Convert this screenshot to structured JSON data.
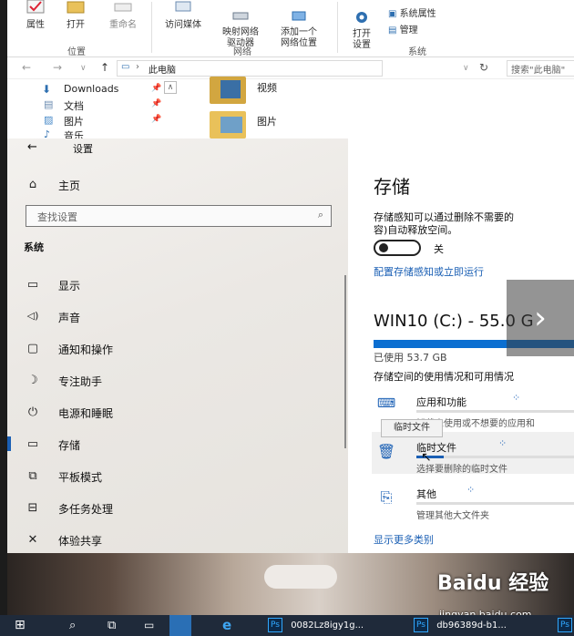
{
  "ribbon": {
    "properties_label": "属性",
    "open_label": "打开",
    "rename_label": "重命名",
    "access_media_label": "访问媒体",
    "map_network_drive_label": "映射网络\n驱动器",
    "add_network_location_label": "添加一个\n网络位置",
    "open_settings_label": "打开\n设置",
    "system_properties_label": "系统属性",
    "manage_label": "管理",
    "group_location": "位置",
    "group_network": "网络",
    "group_system": "系统"
  },
  "address": {
    "path": "此电脑",
    "search_placeholder": "搜索\"此电脑\""
  },
  "nav_pane": {
    "items": [
      {
        "label": "Downloads",
        "icon": "download-icon"
      },
      {
        "label": "文档",
        "icon": "document-icon"
      },
      {
        "label": "图片",
        "icon": "picture-icon"
      },
      {
        "label": "音乐",
        "icon": "music-icon"
      }
    ]
  },
  "folders": {
    "videos": "视频",
    "pictures": "图片"
  },
  "settings": {
    "back_label": "设置",
    "home_label": "主页",
    "search_placeholder": "查找设置",
    "section_title": "系统",
    "nav": [
      {
        "label": "显示",
        "icon": "monitor-icon"
      },
      {
        "label": "声音",
        "icon": "speaker-icon"
      },
      {
        "label": "通知和操作",
        "icon": "notification-icon"
      },
      {
        "label": "专注助手",
        "icon": "moon-icon"
      },
      {
        "label": "电源和睡眠",
        "icon": "power-icon"
      },
      {
        "label": "存储",
        "icon": "storage-icon"
      },
      {
        "label": "平板模式",
        "icon": "tablet-icon"
      },
      {
        "label": "多任务处理",
        "icon": "multitask-icon"
      },
      {
        "label": "体验共享",
        "icon": "share-icon"
      }
    ]
  },
  "storage": {
    "title": "存储",
    "sense_desc_1": "存储感知可以通过删除不需要的",
    "sense_desc_2": "容)自动释放空间。",
    "toggle_state": "关",
    "configure_link": "配置存储感知或立即运行",
    "drive_name": "WIN10 (C:) - 55.0 G",
    "used_text": "已使用 53.7 GB",
    "usage_heading": "存储空间的使用情况和可用情况",
    "drive_used_fraction": 0.98,
    "categories": [
      {
        "name": "应用和功能",
        "desc": "卸载未使用或不想要的应用和",
        "icon": "apps-icon"
      },
      {
        "name": "临时文件",
        "desc": "选择要删除的临时文件",
        "icon": "trash-icon"
      },
      {
        "name": "其他",
        "desc": "管理其他大文件夹",
        "icon": "folder-icon"
      }
    ],
    "show_more_link": "显示更多类别",
    "tooltip": "临时文件"
  },
  "taskbar": {
    "task1": "0082Lz8igy1g...",
    "task2": "db96389d-b1..."
  },
  "watermark": {
    "brand": "Baidu 经验",
    "url": "jingyan.baidu.com"
  },
  "colors": {
    "accent": "#1a5fb4",
    "drive_bar": "#0b6fd1",
    "taskbar": "#1f2a3a"
  }
}
